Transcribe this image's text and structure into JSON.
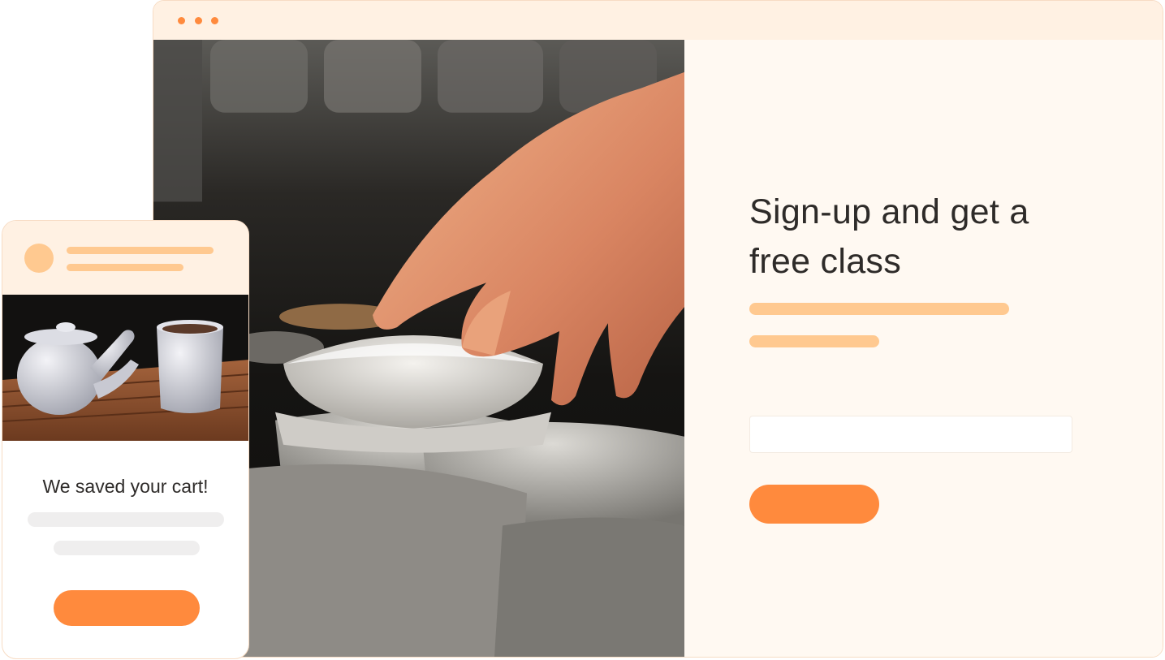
{
  "colors": {
    "accent": "#ff8a3d",
    "accent_light": "#ffc990",
    "panel_bg": "#fff9f2",
    "header_bg": "#fff1e3",
    "text": "#2e2b29",
    "placeholder_gray": "#efeeee"
  },
  "browser": {
    "window_controls": [
      "dot-icon",
      "dot-icon",
      "dot-icon"
    ],
    "hero_image": "hand-picking-ceramic-bowl-photo",
    "form": {
      "headline": "Sign-up and get a free class",
      "email_input": {
        "value": "",
        "placeholder": ""
      },
      "submit_label": ""
    }
  },
  "mobile": {
    "product_image": "teapot-and-cup-photo",
    "title": "We saved your cart!",
    "cta_label": ""
  }
}
